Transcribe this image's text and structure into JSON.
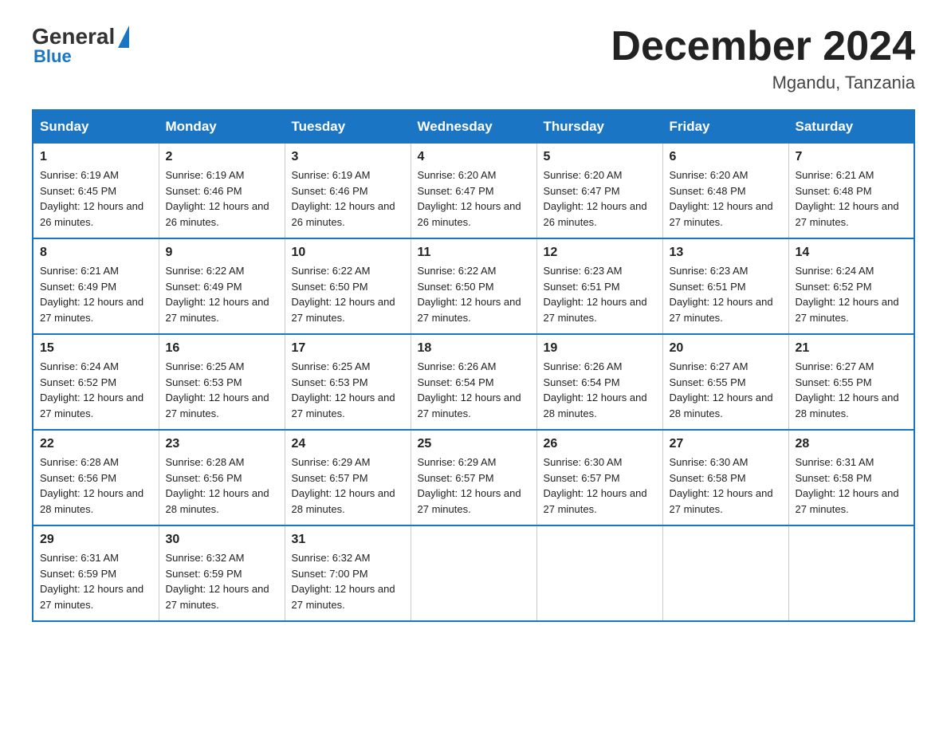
{
  "header": {
    "logo_general": "General",
    "logo_blue": "Blue",
    "month_title": "December 2024",
    "location": "Mgandu, Tanzania"
  },
  "days_of_week": [
    "Sunday",
    "Monday",
    "Tuesday",
    "Wednesday",
    "Thursday",
    "Friday",
    "Saturday"
  ],
  "weeks": [
    [
      {
        "day": "1",
        "sunrise": "6:19 AM",
        "sunset": "6:45 PM",
        "daylight": "12 hours and 26 minutes."
      },
      {
        "day": "2",
        "sunrise": "6:19 AM",
        "sunset": "6:46 PM",
        "daylight": "12 hours and 26 minutes."
      },
      {
        "day": "3",
        "sunrise": "6:19 AM",
        "sunset": "6:46 PM",
        "daylight": "12 hours and 26 minutes."
      },
      {
        "day": "4",
        "sunrise": "6:20 AM",
        "sunset": "6:47 PM",
        "daylight": "12 hours and 26 minutes."
      },
      {
        "day": "5",
        "sunrise": "6:20 AM",
        "sunset": "6:47 PM",
        "daylight": "12 hours and 26 minutes."
      },
      {
        "day": "6",
        "sunrise": "6:20 AM",
        "sunset": "6:48 PM",
        "daylight": "12 hours and 27 minutes."
      },
      {
        "day": "7",
        "sunrise": "6:21 AM",
        "sunset": "6:48 PM",
        "daylight": "12 hours and 27 minutes."
      }
    ],
    [
      {
        "day": "8",
        "sunrise": "6:21 AM",
        "sunset": "6:49 PM",
        "daylight": "12 hours and 27 minutes."
      },
      {
        "day": "9",
        "sunrise": "6:22 AM",
        "sunset": "6:49 PM",
        "daylight": "12 hours and 27 minutes."
      },
      {
        "day": "10",
        "sunrise": "6:22 AM",
        "sunset": "6:50 PM",
        "daylight": "12 hours and 27 minutes."
      },
      {
        "day": "11",
        "sunrise": "6:22 AM",
        "sunset": "6:50 PM",
        "daylight": "12 hours and 27 minutes."
      },
      {
        "day": "12",
        "sunrise": "6:23 AM",
        "sunset": "6:51 PM",
        "daylight": "12 hours and 27 minutes."
      },
      {
        "day": "13",
        "sunrise": "6:23 AM",
        "sunset": "6:51 PM",
        "daylight": "12 hours and 27 minutes."
      },
      {
        "day": "14",
        "sunrise": "6:24 AM",
        "sunset": "6:52 PM",
        "daylight": "12 hours and 27 minutes."
      }
    ],
    [
      {
        "day": "15",
        "sunrise": "6:24 AM",
        "sunset": "6:52 PM",
        "daylight": "12 hours and 27 minutes."
      },
      {
        "day": "16",
        "sunrise": "6:25 AM",
        "sunset": "6:53 PM",
        "daylight": "12 hours and 27 minutes."
      },
      {
        "day": "17",
        "sunrise": "6:25 AM",
        "sunset": "6:53 PM",
        "daylight": "12 hours and 27 minutes."
      },
      {
        "day": "18",
        "sunrise": "6:26 AM",
        "sunset": "6:54 PM",
        "daylight": "12 hours and 27 minutes."
      },
      {
        "day": "19",
        "sunrise": "6:26 AM",
        "sunset": "6:54 PM",
        "daylight": "12 hours and 28 minutes."
      },
      {
        "day": "20",
        "sunrise": "6:27 AM",
        "sunset": "6:55 PM",
        "daylight": "12 hours and 28 minutes."
      },
      {
        "day": "21",
        "sunrise": "6:27 AM",
        "sunset": "6:55 PM",
        "daylight": "12 hours and 28 minutes."
      }
    ],
    [
      {
        "day": "22",
        "sunrise": "6:28 AM",
        "sunset": "6:56 PM",
        "daylight": "12 hours and 28 minutes."
      },
      {
        "day": "23",
        "sunrise": "6:28 AM",
        "sunset": "6:56 PM",
        "daylight": "12 hours and 28 minutes."
      },
      {
        "day": "24",
        "sunrise": "6:29 AM",
        "sunset": "6:57 PM",
        "daylight": "12 hours and 28 minutes."
      },
      {
        "day": "25",
        "sunrise": "6:29 AM",
        "sunset": "6:57 PM",
        "daylight": "12 hours and 27 minutes."
      },
      {
        "day": "26",
        "sunrise": "6:30 AM",
        "sunset": "6:57 PM",
        "daylight": "12 hours and 27 minutes."
      },
      {
        "day": "27",
        "sunrise": "6:30 AM",
        "sunset": "6:58 PM",
        "daylight": "12 hours and 27 minutes."
      },
      {
        "day": "28",
        "sunrise": "6:31 AM",
        "sunset": "6:58 PM",
        "daylight": "12 hours and 27 minutes."
      }
    ],
    [
      {
        "day": "29",
        "sunrise": "6:31 AM",
        "sunset": "6:59 PM",
        "daylight": "12 hours and 27 minutes."
      },
      {
        "day": "30",
        "sunrise": "6:32 AM",
        "sunset": "6:59 PM",
        "daylight": "12 hours and 27 minutes."
      },
      {
        "day": "31",
        "sunrise": "6:32 AM",
        "sunset": "7:00 PM",
        "daylight": "12 hours and 27 minutes."
      },
      null,
      null,
      null,
      null
    ]
  ],
  "labels": {
    "sunrise_prefix": "Sunrise: ",
    "sunset_prefix": "Sunset: ",
    "daylight_prefix": "Daylight: "
  }
}
